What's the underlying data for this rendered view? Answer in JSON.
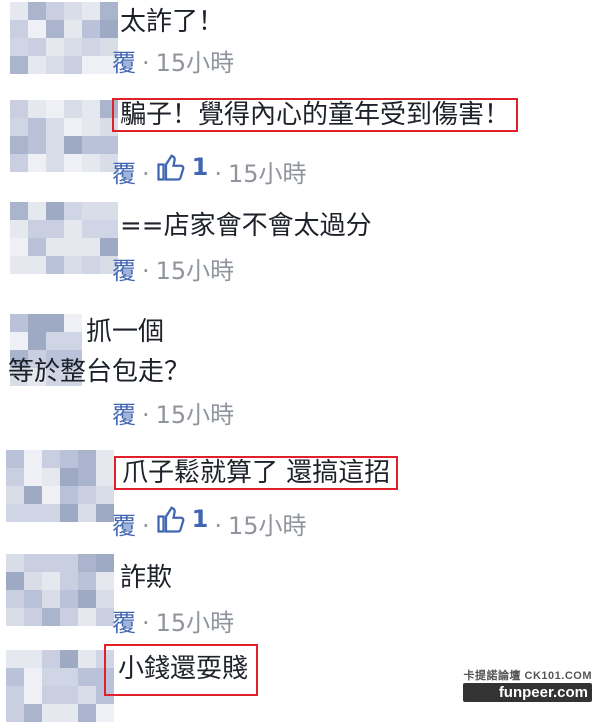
{
  "comments": [
    {
      "text": "太詐了！",
      "reply_fragment": "覆",
      "time": "15小時",
      "likes": ""
    },
    {
      "text": "騙子！覺得內心的童年受到傷害！",
      "reply_fragment": "覆",
      "time": "15小時",
      "likes": "1"
    },
    {
      "text": "==店家會不會太過分",
      "reply_fragment": "覆",
      "time": "15小時",
      "likes": ""
    },
    {
      "text_line1": "抓一個",
      "text_line2": "等於整台包走？",
      "reply_fragment": "覆",
      "time": "15小時",
      "likes": ""
    },
    {
      "text": "爪子鬆就算了 還搞這招",
      "reply_fragment": "覆",
      "time": "15小時",
      "likes": "1"
    },
    {
      "text": "詐欺",
      "reply_fragment": "覆",
      "time": "15小時",
      "likes": ""
    },
    {
      "text": "小錢還耍賤"
    }
  ],
  "separator": "·",
  "watermark": {
    "line1": "卡提諾論壇 CK101.COM",
    "line2": "funpeer.com"
  },
  "colors": {
    "text": "#1d2129",
    "meta": "#90949c",
    "link": "#4267b2",
    "highlight": "#e0202a"
  },
  "icons": {
    "like": "thumbs-up-icon"
  }
}
